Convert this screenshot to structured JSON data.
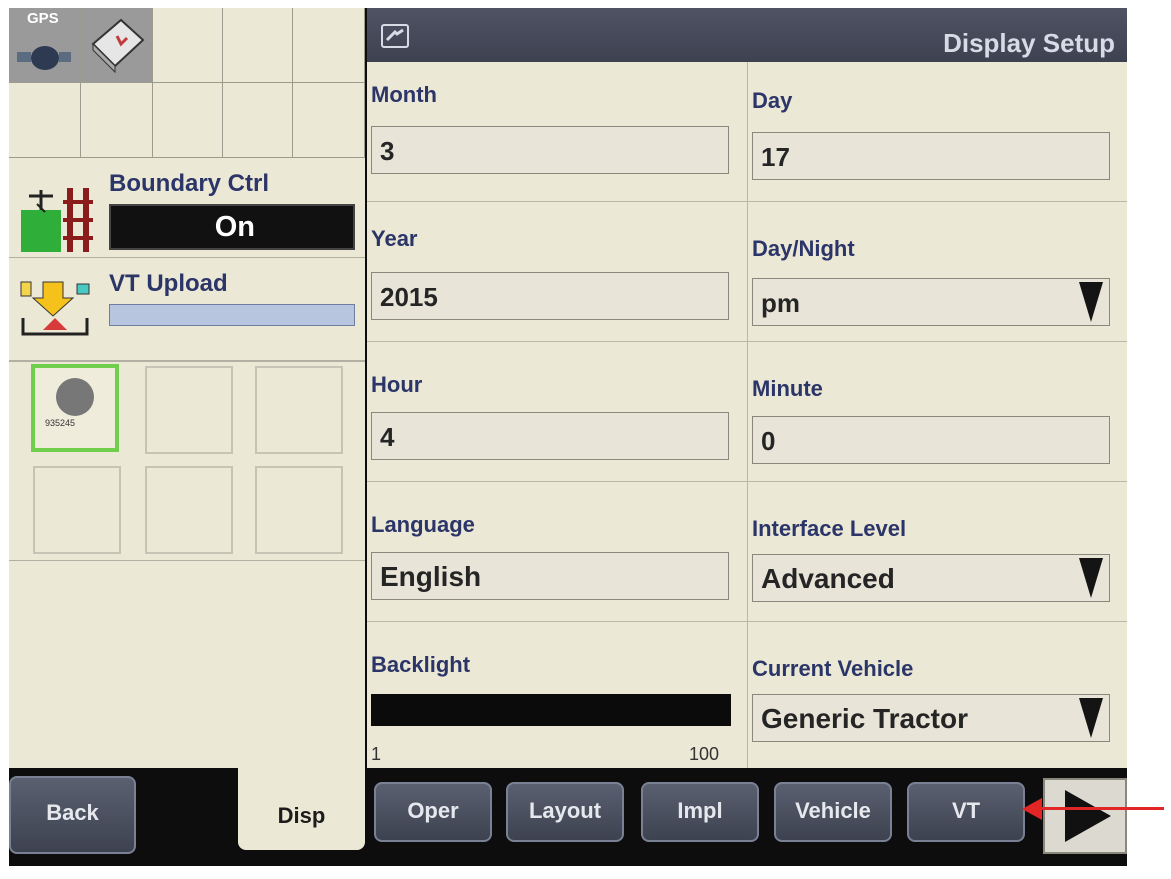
{
  "header": {
    "title": "Display Setup",
    "icon": "setup-icon"
  },
  "left_panel": {
    "gps_label": "GPS",
    "boundary": {
      "label": "Boundary Ctrl",
      "value": "On"
    },
    "vt_upload": {
      "label": "VT Upload",
      "progress": 0
    },
    "slot_text": "935245"
  },
  "form": {
    "month": {
      "label": "Month",
      "value": "3"
    },
    "day": {
      "label": "Day",
      "value": "17"
    },
    "year": {
      "label": "Year",
      "value": "2015"
    },
    "day_night": {
      "label": "Day/Night",
      "value": "pm"
    },
    "hour": {
      "label": "Hour",
      "value": "4"
    },
    "minute": {
      "label": "Minute",
      "value": "0"
    },
    "language": {
      "label": "Language",
      "value": "English"
    },
    "interface_level": {
      "label": "Interface Level",
      "value": "Advanced"
    },
    "backlight": {
      "label": "Backlight",
      "min": "1",
      "max": "100"
    },
    "current_vehicle": {
      "label": "Current Vehicle",
      "value": "Generic Tractor"
    }
  },
  "bottom_nav": {
    "back": "Back",
    "disp": "Disp",
    "oper": "Oper",
    "layout": "Layout",
    "impl": "Impl",
    "vehicle": "Vehicle",
    "vt": "VT"
  },
  "colors": {
    "accent_text": "#2b3568",
    "background": "#ece8d6",
    "annotation_arrow": "#e22626",
    "active_slot": "#6fce4c"
  }
}
